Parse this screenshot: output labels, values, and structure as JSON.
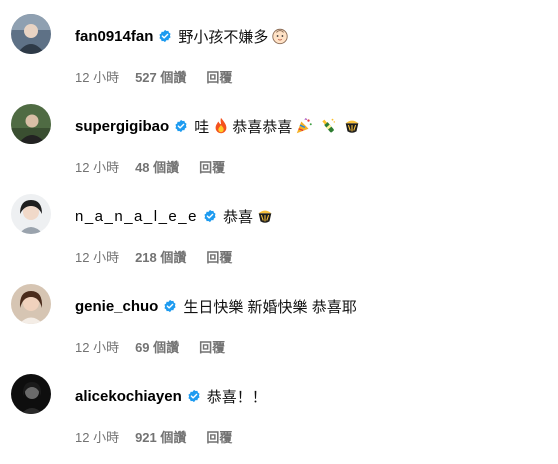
{
  "comments": [
    {
      "username": "fan0914fan",
      "text": "野小孩不嫌多",
      "emojis": [
        "baby-face-emoji"
      ],
      "time": "12 小時",
      "likes": "527 個讚",
      "reply": "回覆",
      "avatar": "avatar-photo"
    },
    {
      "username": "supergigibao",
      "text": "哇",
      "text2": "恭喜恭喜",
      "emojis": [
        "fire-emoji",
        "party-popper-emoji",
        "champagne-emoji",
        "tada-emoji"
      ],
      "time": "12 小時",
      "likes": "48 個讚",
      "reply": "回覆",
      "avatar": "avatar-photo"
    },
    {
      "username": "n_a_n_a_l_e_e",
      "text": "恭喜",
      "emojis": [
        "tada-emoji"
      ],
      "time": "12 小時",
      "likes": "218 個讚",
      "reply": "回覆",
      "avatar": "avatar-photo"
    },
    {
      "username": "genie_chuo",
      "text": "生日快樂 新婚快樂 恭喜耶",
      "emojis": [],
      "time": "12 小時",
      "likes": "69 個讚",
      "reply": "回覆",
      "avatar": "avatar-photo"
    },
    {
      "username": "alicekochiayen",
      "text": "恭喜！！",
      "emojis": [],
      "time": "12 小時",
      "likes": "921 個讚",
      "reply": "回覆",
      "avatar": "avatar-photo"
    }
  ],
  "colors": {
    "verified": "#1d9bf0",
    "meta": "#737373"
  }
}
